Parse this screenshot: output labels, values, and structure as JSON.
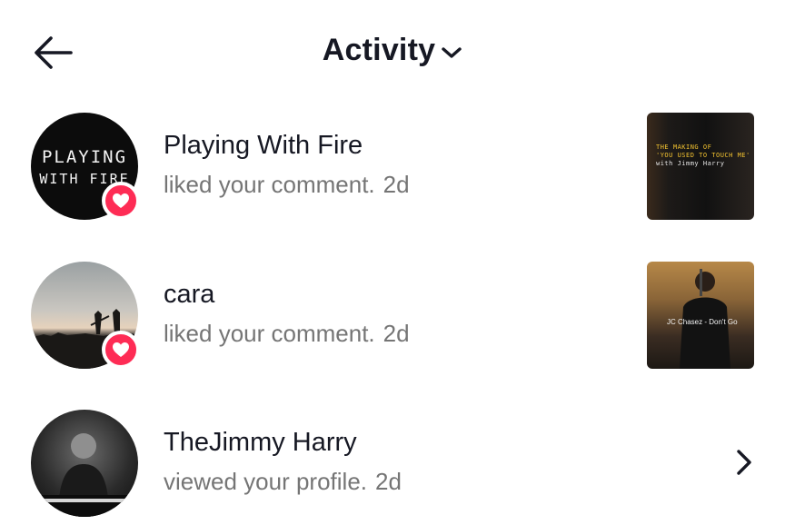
{
  "header": {
    "title": "Activity",
    "back_icon": "arrow-left-icon",
    "dropdown_icon": "chevron-down-icon"
  },
  "activities": [
    {
      "name": "Playing With Fire",
      "action": "liked your comment.",
      "time": "2d",
      "badge_icon": "heart-icon",
      "avatar_text_line1": "PLAYING",
      "avatar_text_line2": "WITH FIRE",
      "thumbnail_caption_line1": "THE MAKING OF",
      "thumbnail_caption_line2": "'YOU USED TO TOUCH ME'",
      "thumbnail_caption_line3": "with Jimmy Harry"
    },
    {
      "name": "cara",
      "action": "liked your comment.",
      "time": "2d",
      "badge_icon": "heart-icon",
      "thumbnail_caption_line1": "JC Chasez - Don't Go"
    },
    {
      "name": "TheJimmy Harry",
      "action": "viewed your profile.",
      "time": "2d",
      "trailing_icon": "chevron-right-icon"
    }
  ],
  "colors": {
    "badge": "#fe2c55",
    "primary_text": "#161823",
    "secondary_text": "#757575"
  }
}
